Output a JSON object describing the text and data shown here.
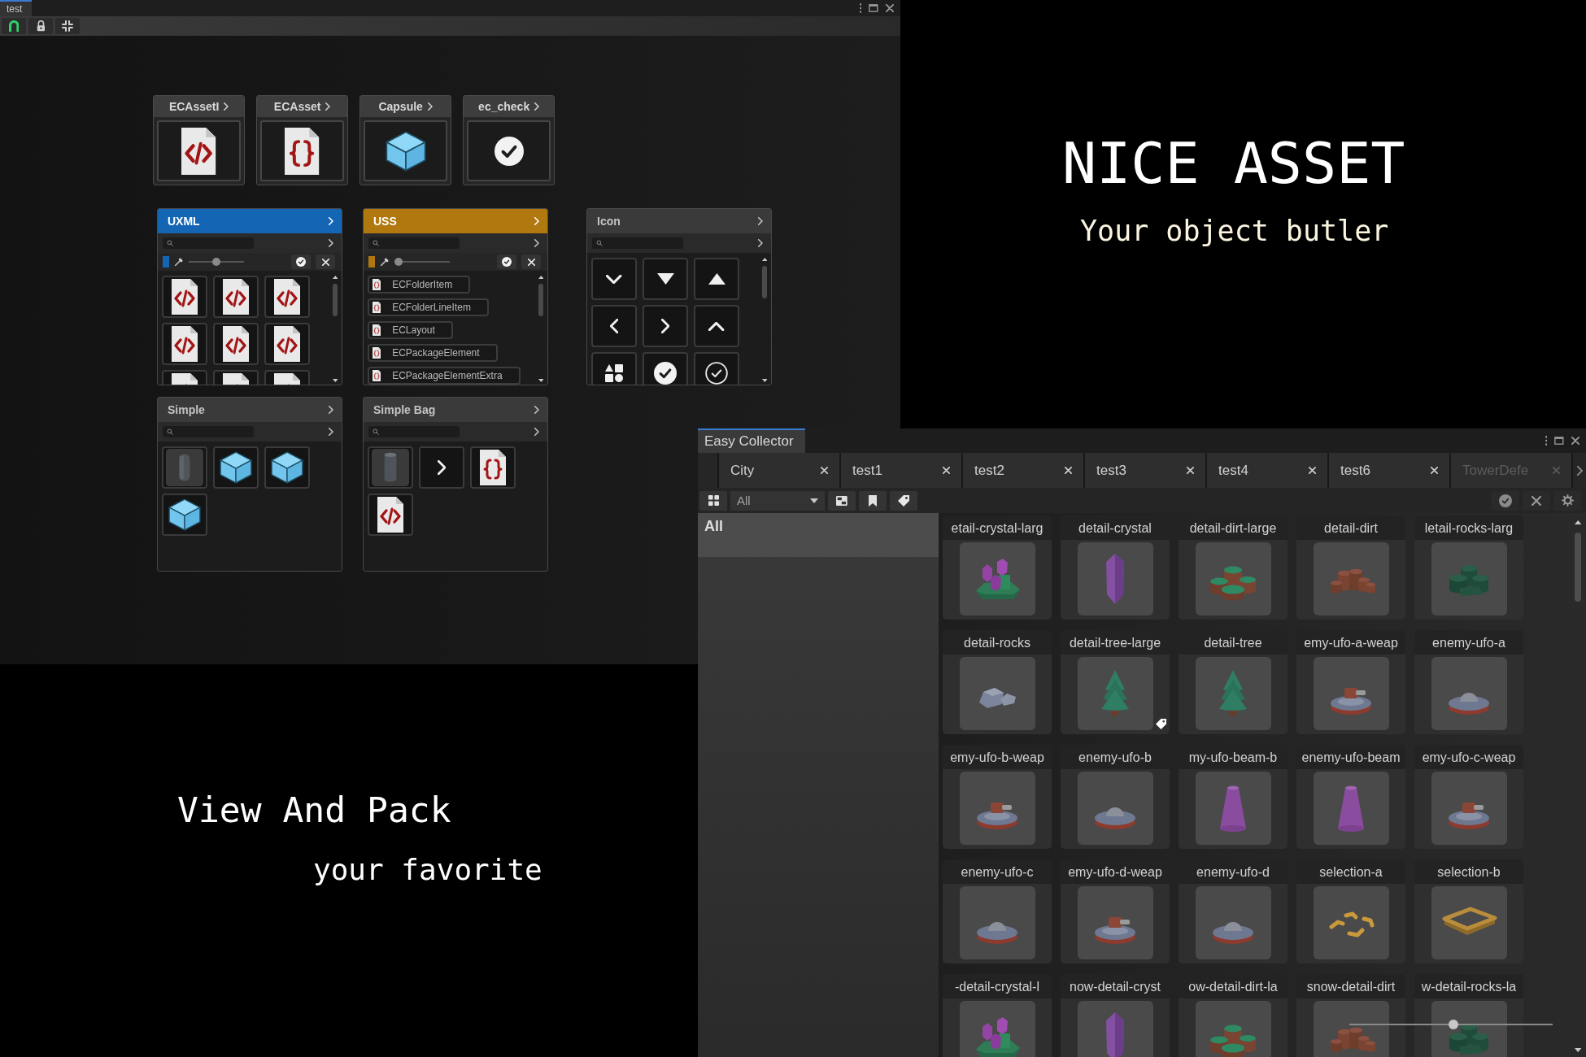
{
  "editor_window": {
    "tab": "test",
    "toolbar": [
      {
        "kind": "magnet"
      },
      {
        "kind": "padlock"
      },
      {
        "kind": "collapse"
      }
    ],
    "asset_cards": [
      {
        "title": "ECAssetI",
        "kind": "code-file"
      },
      {
        "title": "ECAsset",
        "kind": "braces-file"
      },
      {
        "title": "Capsule",
        "kind": "cube"
      },
      {
        "title": "ec_check",
        "kind": "check"
      }
    ],
    "panel_rows": [
      [
        {
          "title": "UXML",
          "color": "#1565b5",
          "toolbar": {
            "level": 0.5
          },
          "items": [
            {
              "kind": "code-file"
            },
            {
              "kind": "code-file"
            },
            {
              "kind": "code-file"
            },
            {
              "kind": "code-file"
            },
            {
              "kind": "code-file"
            },
            {
              "kind": "code-file"
            },
            {
              "kind": "code-file"
            },
            {
              "kind": "code-file"
            },
            {
              "kind": "code-file"
            }
          ]
        },
        {
          "title": "USS",
          "color": "#b0780f",
          "toolbar": {
            "level": 0.08
          },
          "items": [
            {
              "kind": "braces-file",
              "label": "ECFolderItem"
            },
            {
              "kind": "braces-file",
              "label": "ECFolderLineItem"
            },
            {
              "kind": "braces-file",
              "label": "ECLayout"
            },
            {
              "kind": "braces-file",
              "label": "ECPackageElement"
            },
            {
              "kind": "braces-file",
              "label": "ECPackageElementExtra"
            }
          ]
        },
        {
          "title": "Icon",
          "items": [
            {
              "kind": "chevron-down"
            },
            {
              "kind": "triangle-down"
            },
            {
              "kind": "triangle-up"
            },
            {
              "kind": "chevron-left"
            },
            {
              "kind": "chevron-right"
            },
            {
              "kind": "chevron-up"
            },
            {
              "kind": "shapes"
            },
            {
              "kind": "check"
            },
            {
              "kind": "check-outline"
            }
          ]
        }
      ],
      [
        {
          "title": "Simple",
          "items": [
            {
              "kind": "capsule"
            },
            {
              "kind": "cube"
            },
            {
              "kind": "cube"
            },
            {
              "kind": "cube"
            }
          ]
        },
        {
          "title": "Simple Bag",
          "items": [
            {
              "kind": "cylinder"
            },
            {
              "kind": "chevron-right"
            },
            {
              "kind": "braces-file"
            },
            {
              "kind": "code-file"
            }
          ]
        }
      ]
    ]
  },
  "headline": "NICE ASSET",
  "tagline": "Your object butler",
  "slogan": [
    "View And Pack",
    "your favorite"
  ],
  "easy_collector": {
    "title": "Easy Collector",
    "tabs": [
      {
        "label": "City",
        "dimmed": false
      },
      {
        "label": "test1",
        "dimmed": false
      },
      {
        "label": "test2",
        "dimmed": false
      },
      {
        "label": "test3",
        "dimmed": false
      },
      {
        "label": "test4",
        "dimmed": false
      },
      {
        "label": "test6",
        "dimmed": false
      },
      {
        "label": "TowerDefe",
        "dimmed": true
      }
    ],
    "filter": {
      "value": "All"
    },
    "sidebar": [
      {
        "label": "All",
        "selected": true
      }
    ],
    "items": [
      {
        "name": "etail-crystal-larg",
        "kind": "crystals",
        "tagged": false
      },
      {
        "name": "detail-crystal",
        "kind": "crystal",
        "tagged": false
      },
      {
        "name": "detail-dirt-large",
        "kind": "mounds",
        "tagged": false
      },
      {
        "name": "detail-dirt",
        "kind": "stumps",
        "tagged": false
      },
      {
        "name": "letail-rocks-larg",
        "kind": "boulders",
        "tagged": false
      },
      {
        "name": "detail-rocks",
        "kind": "rocks",
        "tagged": false
      },
      {
        "name": "detail-tree-large",
        "kind": "tree",
        "tagged": true
      },
      {
        "name": "detail-tree",
        "kind": "tree",
        "tagged": false
      },
      {
        "name": "emy-ufo-a-weap",
        "kind": "turret",
        "tagged": false
      },
      {
        "name": "enemy-ufo-a",
        "kind": "saucer",
        "tagged": false
      },
      {
        "name": "emy-ufo-b-weap",
        "kind": "turret",
        "tagged": false
      },
      {
        "name": "enemy-ufo-b",
        "kind": "saucer",
        "tagged": false
      },
      {
        "name": "my-ufo-beam-b",
        "kind": "cone",
        "tagged": false
      },
      {
        "name": "enemy-ufo-beam",
        "kind": "cone",
        "tagged": false
      },
      {
        "name": "emy-ufo-c-weap",
        "kind": "turret",
        "tagged": false
      },
      {
        "name": "enemy-ufo-c",
        "kind": "saucer",
        "tagged": false
      },
      {
        "name": "emy-ufo-d-weap",
        "kind": "turret",
        "tagged": false
      },
      {
        "name": "enemy-ufo-d",
        "kind": "saucer",
        "tagged": false
      },
      {
        "name": "selection-a",
        "kind": "corners",
        "tagged": false
      },
      {
        "name": "selection-b",
        "kind": "frame",
        "tagged": false
      },
      {
        "name": "-detail-crystal-l",
        "kind": "crystals"
      },
      {
        "name": "now-detail-cryst",
        "kind": "crystal"
      },
      {
        "name": "ow-detail-dirt-la",
        "kind": "mounds"
      },
      {
        "name": "snow-detail-dirt",
        "kind": "stumps"
      },
      {
        "name": "w-detail-rocks-la",
        "kind": "boulders"
      }
    ],
    "zoom_slider": {
      "level": 0.51
    }
  }
}
